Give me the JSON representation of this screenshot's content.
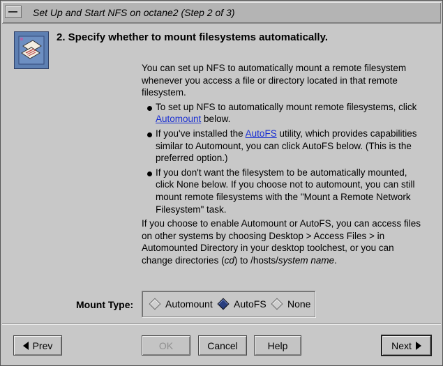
{
  "window": {
    "title": "Set Up and Start NFS on octane2 (Step 2 of 3)"
  },
  "step": {
    "heading": "2. Specify whether to mount filesystems automatically."
  },
  "intro": "You can set up NFS to automatically mount a remote filesystem whenever you access a file or directory located in that remote filesystem.",
  "bullets": [
    {
      "before": "To set up NFS to automatically mount remote filesystems, click ",
      "link": "Automount",
      "after": " below."
    },
    {
      "before": "If you've installed the ",
      "link": "AutoFS",
      "after": " utility, which provides capabilities similar to Automount, you can click AutoFS below. (This is the preferred option.)"
    },
    {
      "text": "If you don't want the filesystem to be automatically mounted, click None below. If you choose not to automount, you can still mount remote filesystems with the \"Mount a Remote Network Filesystem\" task."
    }
  ],
  "closing": {
    "part1": "If you choose to enable Automount or AutoFS, you can access files on other systems by choosing Desktop > Access Files > in Automounted Directory in your desktop toolchest, or you can change directories (",
    "cd": "cd",
    "part2": ") to /hosts/",
    "system_name": "system name",
    "part3": "."
  },
  "mount_type": {
    "label": "Mount Type:",
    "options": [
      "Automount",
      "AutoFS",
      "None"
    ],
    "selected": "AutoFS"
  },
  "buttons": {
    "prev": "Prev",
    "ok": "OK",
    "cancel": "Cancel",
    "help": "Help",
    "next": "Next"
  }
}
